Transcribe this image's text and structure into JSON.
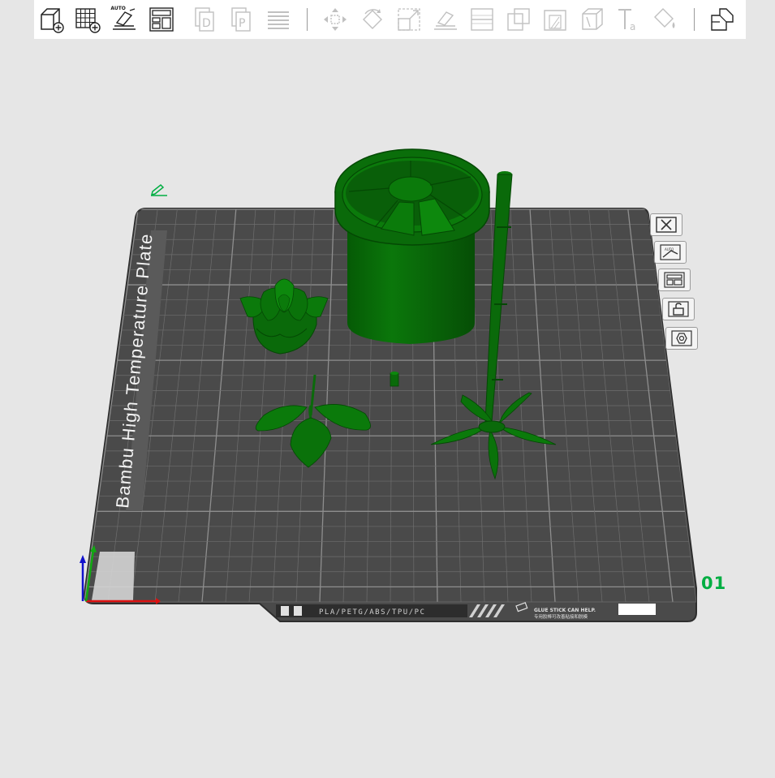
{
  "toolbar": {
    "buttons": [
      {
        "icon": "add-object-icon",
        "enabled": true
      },
      {
        "icon": "add-plate-icon",
        "enabled": true
      },
      {
        "icon": "auto-orient-icon",
        "enabled": true,
        "tag": "AUTO"
      },
      {
        "icon": "arrange-icon",
        "enabled": true
      },
      {
        "icon": "copy-icon",
        "enabled": false
      },
      {
        "icon": "paste-icon",
        "enabled": false
      },
      {
        "icon": "layers-icon",
        "enabled": false
      },
      {
        "icon": "move-icon",
        "enabled": false
      },
      {
        "icon": "rotate-icon",
        "enabled": false
      },
      {
        "icon": "scale-icon",
        "enabled": false
      },
      {
        "icon": "lay-on-face-icon",
        "enabled": false
      },
      {
        "icon": "cut-icon",
        "enabled": false
      },
      {
        "icon": "boolean-icon",
        "enabled": false
      },
      {
        "icon": "support-paint-icon",
        "enabled": false
      },
      {
        "icon": "seam-paint-icon",
        "enabled": false
      },
      {
        "icon": "text-icon",
        "enabled": false
      },
      {
        "icon": "color-paint-icon",
        "enabled": false
      },
      {
        "icon": "assembly-view-icon",
        "enabled": true
      }
    ]
  },
  "plate": {
    "name": "Bambu High Temperature Plate",
    "number": "01",
    "filament_label": "PLA/PETG/ABS/TPU/PC",
    "glue_text": "GLUE STICK CAN HELP.",
    "glue_text_cn": "专用胶棒可改善粘接和脱模"
  },
  "plate_buttons": [
    {
      "icon": "close-plate-icon"
    },
    {
      "icon": "orient-plate-icon"
    },
    {
      "icon": "arrange-plate-icon"
    },
    {
      "icon": "lock-plate-icon"
    },
    {
      "icon": "plate-settings-icon"
    }
  ],
  "colors": {
    "accent": "#00ae42",
    "model": "#0a6a0a",
    "plate": "#4a4a4a",
    "background": "#e6e6e6"
  }
}
